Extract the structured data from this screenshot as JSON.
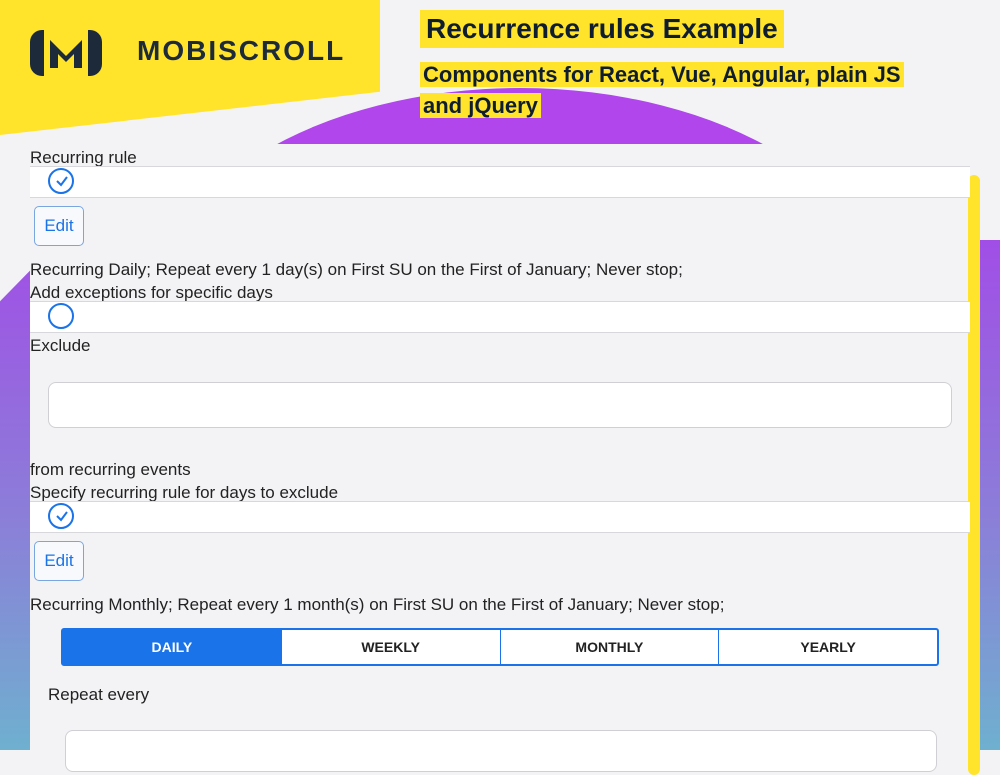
{
  "header": {
    "brand": "MOBISCROLL",
    "title": "Recurrence rules Example",
    "subtitle": "Components for React, Vue, Angular, plain JS and jQuery"
  },
  "recurring_rule": {
    "label": "Recurring rule",
    "checked": true,
    "edit_label": "Edit",
    "summary": "Recurring Daily; Repeat every 1 day(s) on First SU on the First of January; Never stop;"
  },
  "exceptions": {
    "label": "Add exceptions for specific days",
    "checked": false,
    "exclude_label": "Exclude",
    "exclude_value": "",
    "from_label": "from recurring events"
  },
  "exclude_rule": {
    "label": "Specify recurring rule for days to exclude",
    "checked": true,
    "edit_label": "Edit",
    "summary": "Recurring Monthly; Repeat every 1 month(s) on First SU on the First of January; Never stop;"
  },
  "frequency_tabs": [
    {
      "label": "DAILY",
      "active": true
    },
    {
      "label": "WEEKLY",
      "active": false
    },
    {
      "label": "MONTHLY",
      "active": false
    },
    {
      "label": "YEARLY",
      "active": false
    }
  ],
  "repeat_every": {
    "label": "Repeat every",
    "value": ""
  },
  "colors": {
    "accent": "#1a73e8",
    "brand_yellow": "#ffe42b",
    "brand_purple": "#b046ec"
  }
}
